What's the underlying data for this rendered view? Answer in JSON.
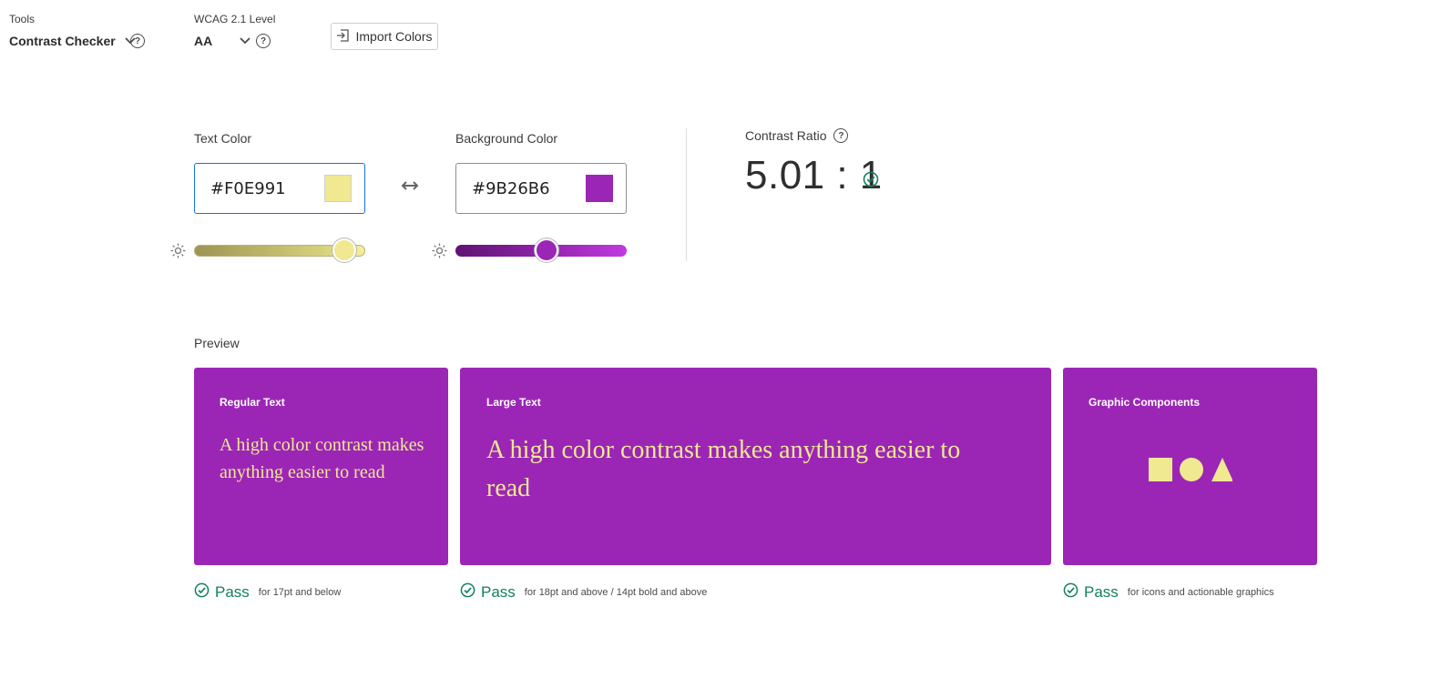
{
  "toolbar": {
    "tools_label": "Tools",
    "tools_value": "Contrast Checker",
    "wcag_label": "WCAG 2.1 Level",
    "wcag_value": "AA",
    "import_label": "Import Colors"
  },
  "text_color": {
    "label": "Text Color",
    "hex": "#F0E991",
    "swatch": "#F0E991",
    "brightness_fraction": 0.88
  },
  "background_color": {
    "label": "Background Color",
    "hex": "#9B26B6",
    "swatch": "#9B26B6",
    "brightness_fraction": 0.53
  },
  "contrast": {
    "label": "Contrast Ratio",
    "value": "5.01 : 1"
  },
  "preview": {
    "label": "Preview",
    "cards": [
      {
        "title": "Regular Text",
        "text": "A high color contrast makes anything easier to read",
        "result": "Pass",
        "note": "for 17pt and below"
      },
      {
        "title": "Large Text",
        "text": "A high color contrast makes anything easier to read",
        "result": "Pass",
        "note": "for 18pt and above / 14pt bold and above"
      },
      {
        "title": "Graphic Components",
        "result": "Pass",
        "note": "for icons and actionable graphics"
      }
    ]
  },
  "colors": {
    "accent_blue": "#1473e6",
    "pass_green": "#12805c",
    "card_bg": "#9B26B6",
    "card_fg": "#F0E991"
  },
  "icons": [
    "chevron-down-icon",
    "help-icon",
    "import-icon",
    "swap-icon",
    "brightness-icon",
    "check-circle-icon",
    "square-icon",
    "circle-icon",
    "triangle-icon"
  ]
}
